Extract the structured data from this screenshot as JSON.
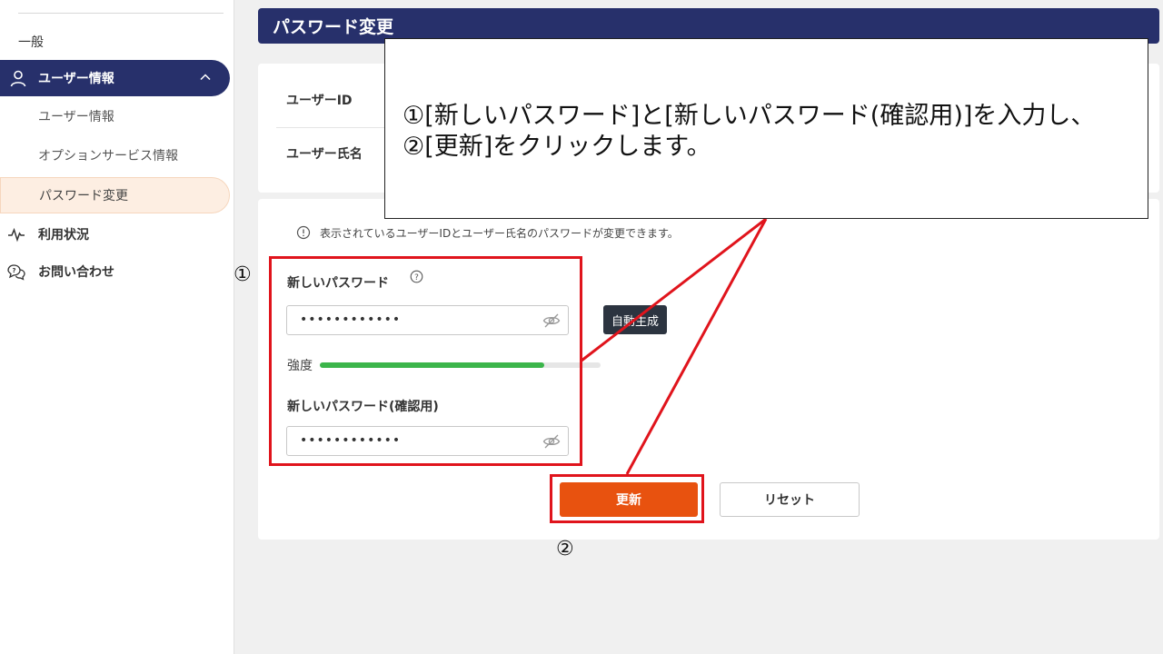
{
  "sidebar": {
    "general": "一般",
    "user_info_header": "ユーザー情報",
    "sub_user_info": "ユーザー情報",
    "sub_option": "オプションサービス情報",
    "sub_password": "パスワード変更",
    "usage": "利用状況",
    "contact": "お問い合わせ"
  },
  "page": {
    "title": "パスワード変更"
  },
  "user_card": {
    "user_id_label": "ユーザーID",
    "user_name_label": "ユーザー氏名"
  },
  "form": {
    "info": "表示されているユーザーIDとユーザー氏名のパスワードが変更できます。",
    "new_password_label": "新しいパスワード",
    "new_password_value": "••••••••••••",
    "auto_generate": "自動生成",
    "strength_label": "強度",
    "strength_percent": 80,
    "confirm_label": "新しいパスワード(確認用)",
    "confirm_value": "••••••••••••",
    "update_button": "更新",
    "reset_button": "リセット"
  },
  "annotation": {
    "line1": "①[新しいパスワード]と[新しいパスワード(確認用)]を入力し、",
    "line2": "②[更新]をクリックします。",
    "mark1": "①",
    "mark2": "②"
  },
  "colors": {
    "navy": "#27306b",
    "accent_orange": "#e8520f",
    "strength_green": "#3bb54a",
    "annotation_red": "#e0141c"
  }
}
